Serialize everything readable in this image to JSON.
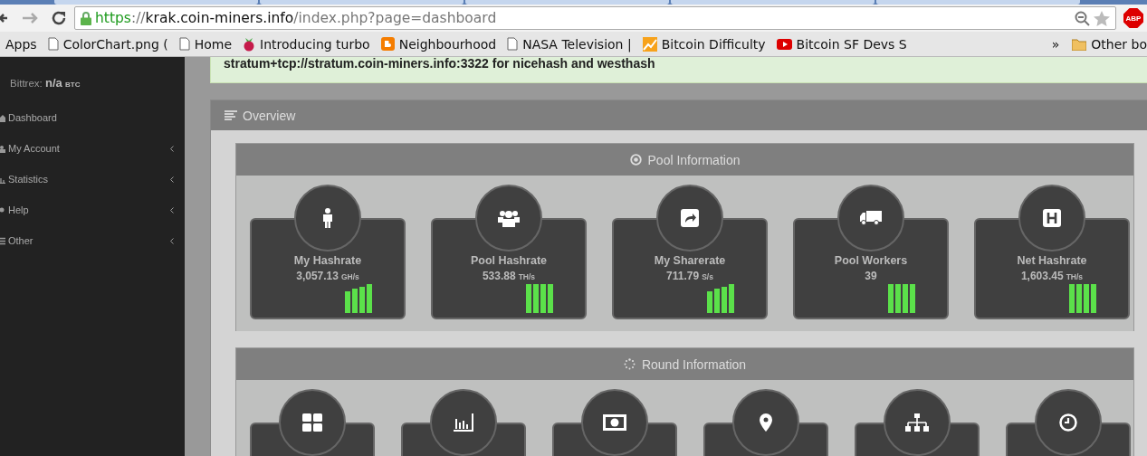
{
  "browser": {
    "url": {
      "scheme": "https",
      "separator": "://",
      "host": "krak.coin-miners.info",
      "path": "/index.php?page=dashboard"
    },
    "bookmarks": [
      {
        "label": "Apps",
        "kind": "apps"
      },
      {
        "label": "ColorChart.png (",
        "kind": "page"
      },
      {
        "label": "Home",
        "kind": "page"
      },
      {
        "label": "Introducing turbo",
        "kind": "raspberry"
      },
      {
        "label": "Neighbourhood",
        "kind": "blog"
      },
      {
        "label": "NASA Television |",
        "kind": "page"
      },
      {
        "label": "Bitcoin Difficulty",
        "kind": "chart"
      },
      {
        "label": "Bitcoin SF Devs S",
        "kind": "video"
      }
    ],
    "overflow": "»",
    "other_bookmarks": "Other bo",
    "adblock_badge": "ABP"
  },
  "sidebar": {
    "ticker": {
      "label": "Bittrex:",
      "value": "n/a",
      "unit": "BTC"
    },
    "items": [
      {
        "label": "Dashboard",
        "has_submenu": false
      },
      {
        "label": "My Account",
        "has_submenu": true
      },
      {
        "label": "Statistics",
        "has_submenu": true
      },
      {
        "label": "Help",
        "has_submenu": true
      },
      {
        "label": "Other",
        "has_submenu": true
      }
    ]
  },
  "alert": {
    "text": "stratum+tcp://stratum.coin-miners.info:3322 for nicehash and westhash"
  },
  "overview": {
    "title": "Overview",
    "pool_information": {
      "title": "Pool Information",
      "cards": [
        {
          "title": "My Hashrate",
          "value": "3,057.13",
          "unit": "GH/s",
          "kind": "rising"
        },
        {
          "title": "Pool Hashrate",
          "value": "533.88",
          "unit": "TH/s",
          "kind": "full"
        },
        {
          "title": "My Sharerate",
          "value": "711.79",
          "unit": "S/s",
          "kind": "rising"
        },
        {
          "title": "Pool Workers",
          "value": "39",
          "kind": "full"
        },
        {
          "title": "Net Hashrate",
          "value": "1,603.45",
          "unit": "TH/s",
          "kind": "full"
        }
      ]
    },
    "round_information": {
      "title": "Round Information"
    }
  }
}
